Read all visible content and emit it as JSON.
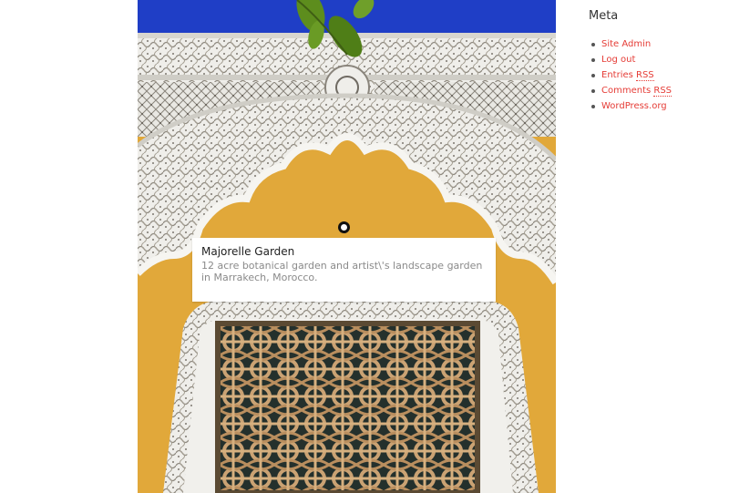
{
  "hero": {
    "image_icon": "moroccan-arch-photo",
    "colors": {
      "sky": "#1f3ec6",
      "wall": "#e1a83a",
      "plaster": "#ecebe6",
      "leaf": "#5d8d1d"
    }
  },
  "hotspot": {
    "title": "Majorelle Garden",
    "description": "12 acre botanical garden and artist\\'s landscape garden in Marrakech, Morocco."
  },
  "sidebar": {
    "widget_title": "Meta",
    "items": [
      {
        "label": "Site Admin"
      },
      {
        "label": "Log out"
      },
      {
        "label_prefix": "Entries ",
        "abbr": "RSS"
      },
      {
        "label_prefix": "Comments ",
        "abbr": "RSS"
      },
      {
        "label": "WordPress.org"
      }
    ],
    "link_color": "#e53c36"
  }
}
